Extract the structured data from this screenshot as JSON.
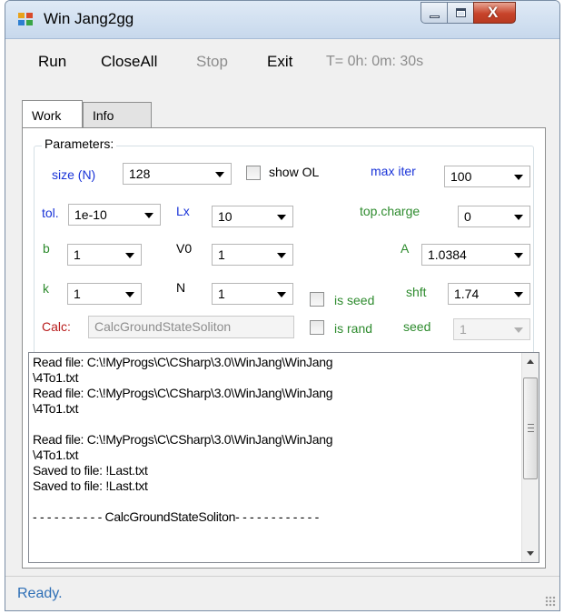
{
  "window": {
    "title": "Win Jang2gg",
    "app_icon": "app-grid-icon",
    "controls": {
      "minimize": "minimize-icon",
      "maximize": "maximize-icon",
      "close_glyph": "X"
    }
  },
  "menu": {
    "items": [
      {
        "label": "Run",
        "enabled": true
      },
      {
        "label": "CloseAll",
        "enabled": true
      },
      {
        "label": "Stop",
        "enabled": false
      },
      {
        "label": "Exit",
        "enabled": true
      }
    ],
    "timer": "T= 0h: 0m: 30s"
  },
  "tabs": [
    {
      "label": "Work",
      "active": true
    },
    {
      "label": "Info",
      "active": false
    }
  ],
  "parameters": {
    "group_label": "Parameters:",
    "size": {
      "label": "size (N)",
      "value": "128"
    },
    "show_ol": {
      "label": "show OL",
      "checked": false
    },
    "max_iter": {
      "label": "max iter",
      "value": "100"
    },
    "tol": {
      "label": "tol.",
      "value": "1e-10"
    },
    "lx": {
      "label": "Lx",
      "value": "10"
    },
    "top_charge": {
      "label": "top.charge",
      "value": "0"
    },
    "b": {
      "label": "b",
      "value": "1"
    },
    "v0": {
      "label": "V0",
      "value": "1"
    },
    "a": {
      "label": "A",
      "value": "1.0384"
    },
    "k": {
      "label": "k",
      "value": "1"
    },
    "n": {
      "label": "N",
      "value": "1"
    },
    "is_seed": {
      "label": "is seed",
      "checked": false
    },
    "shft": {
      "label": "shft",
      "value": "1.74"
    },
    "calc": {
      "label": "Calc:",
      "value": "CalcGroundStateSoliton"
    },
    "is_rand": {
      "label": "is rand",
      "checked": false
    },
    "seed": {
      "label": "seed",
      "value": "1",
      "enabled": false
    }
  },
  "log": {
    "lines": [
      "Read file: C:\\!MyProgs\\C\\CSharp\\3.0\\WinJang\\WinJang",
      "\\4To1.txt",
      "Read file: C:\\!MyProgs\\C\\CSharp\\3.0\\WinJang\\WinJang",
      "\\4To1.txt",
      "",
      "Read file: C:\\!MyProgs\\C\\CSharp\\3.0\\WinJang\\WinJang",
      "\\4To1.txt",
      "Saved to file: !Last.txt",
      "Saved to file: !Last.txt",
      "",
      "- - - - - - - - - - CalcGroundStateSoliton- - - - - - - - - - - -"
    ]
  },
  "status": {
    "text": "Ready."
  },
  "colors": {
    "label_blue": "#1a34d8",
    "label_green": "#2e8b2e",
    "label_red": "#b81c1c",
    "status_blue": "#2e6fb6",
    "disabled_gray": "#8d8d8d"
  }
}
